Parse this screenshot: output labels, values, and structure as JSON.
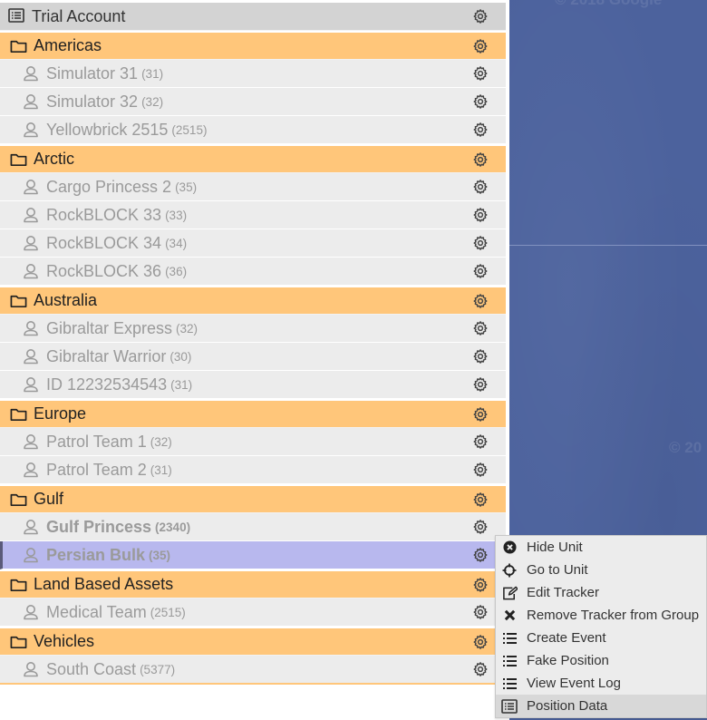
{
  "map": {
    "watermarks": [
      "© 2018 Google",
      "© 20"
    ],
    "colors": {
      "water": "#4c629d"
    }
  },
  "tree": {
    "account": {
      "label": "Trial Account",
      "icon": "list-alt-icon"
    },
    "groups": [
      {
        "label": "Americas",
        "units": [
          {
            "name": "Simulator 31",
            "id": "(31)"
          },
          {
            "name": "Simulator 32",
            "id": "(32)"
          },
          {
            "name": "Yellowbrick 2515",
            "id": "(2515)"
          }
        ]
      },
      {
        "label": "Arctic",
        "units": [
          {
            "name": "Cargo Princess 2",
            "id": "(35)"
          },
          {
            "name": "RockBLOCK 33",
            "id": "(33)"
          },
          {
            "name": "RockBLOCK 34",
            "id": "(34)"
          },
          {
            "name": "RockBLOCK 36",
            "id": "(36)"
          }
        ]
      },
      {
        "label": "Australia",
        "units": [
          {
            "name": "Gibraltar Express",
            "id": "(32)"
          },
          {
            "name": "Gibraltar Warrior",
            "id": "(30)"
          },
          {
            "name": "ID 12232534543",
            "id": "(31)"
          }
        ]
      },
      {
        "label": "Europe",
        "units": [
          {
            "name": "Patrol Team 1",
            "id": "(32)"
          },
          {
            "name": "Patrol Team 2",
            "id": "(31)"
          }
        ]
      },
      {
        "label": "Gulf",
        "units": [
          {
            "name": "Gulf Princess",
            "id": "(2340)",
            "bold": true
          },
          {
            "name": "Persian Bulk",
            "id": "(35)",
            "bold": true,
            "selected": true
          }
        ]
      },
      {
        "label": "Land Based Assets",
        "units": [
          {
            "name": "Medical Team",
            "id": "(2515)"
          }
        ]
      },
      {
        "label": "Vehicles",
        "units": [
          {
            "name": "South Coast",
            "id": "(5377)"
          }
        ]
      }
    ],
    "colors": {
      "group_bg": "#ffc67a",
      "unit_bg": "#ececec",
      "selected_bg": "#b8b8ee",
      "account_bg": "#d3d3d3"
    }
  },
  "context_menu": {
    "items": [
      {
        "label": "Hide Unit",
        "icon": "times-circle-icon"
      },
      {
        "label": "Go to Unit",
        "icon": "crosshairs-icon"
      },
      {
        "label": "Edit Tracker",
        "icon": "edit-icon"
      },
      {
        "label": "Remove Tracker from Group",
        "icon": "close-icon"
      },
      {
        "label": "Create Event",
        "icon": "list-icon"
      },
      {
        "label": "Fake Position",
        "icon": "list-icon"
      },
      {
        "label": "View Event Log",
        "icon": "list-icon"
      },
      {
        "label": "Position Data",
        "icon": "list-alt-icon",
        "hovered": true
      }
    ]
  }
}
